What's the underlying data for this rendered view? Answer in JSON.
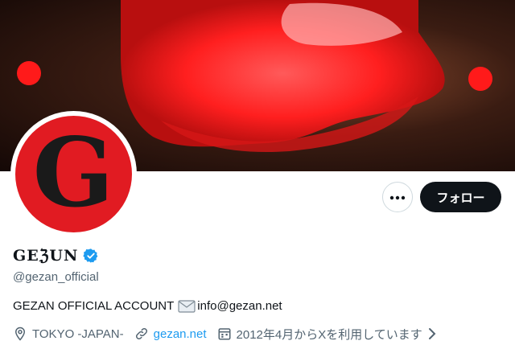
{
  "profile": {
    "display_name": "GEℨUN",
    "handle": "@gezan_official",
    "bio_text": "GEZAN OFFICIAL ACCOUNT",
    "bio_email": "info@gezan.net",
    "location": "TOKYO -JAPAN-",
    "website": "gezan.net",
    "joined": "2012年4月からXを利用しています",
    "avatar_letter": "G"
  },
  "actions": {
    "follow_label": "フォロー",
    "more_label": "•••"
  },
  "colors": {
    "brand_red": "#e11b22",
    "verified_blue": "#1d9bf0",
    "link_blue": "#1d9bf0",
    "button_dark": "#0f1419",
    "muted_text": "#536471"
  },
  "icons": {
    "more": "more-horizontal-icon",
    "verified": "verified-badge-icon",
    "mail": "envelope-icon",
    "location": "location-pin-icon",
    "link": "link-icon",
    "calendar": "calendar-icon",
    "chevron": "chevron-right-icon"
  }
}
